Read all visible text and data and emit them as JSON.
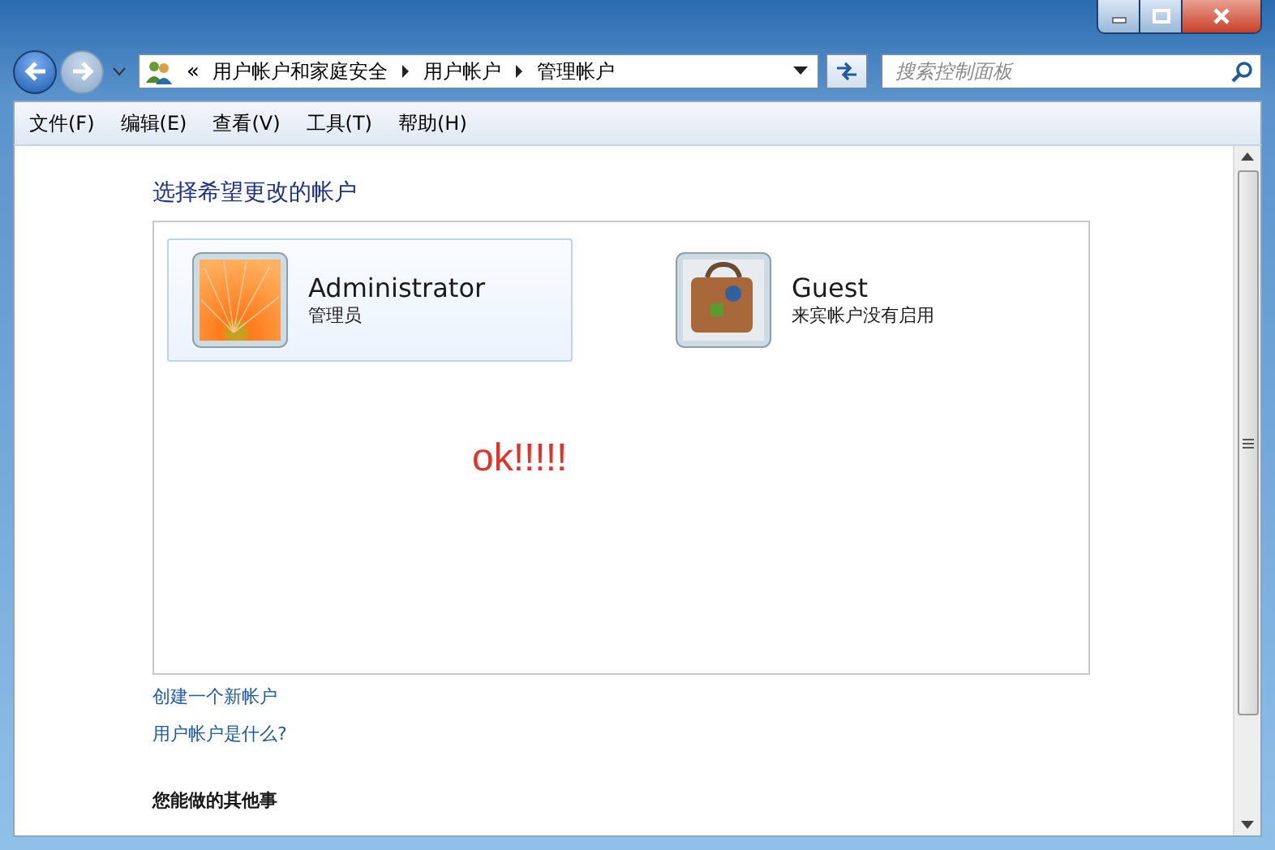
{
  "address_bar": {
    "overflow": "«",
    "path": [
      "用户帐户和家庭安全",
      "用户帐户",
      "管理帐户"
    ]
  },
  "search": {
    "placeholder": "搜索控制面板"
  },
  "menu": [
    "文件(F)",
    "编辑(E)",
    "查看(V)",
    "工具(T)",
    "帮助(H)"
  ],
  "heading": "选择希望更改的帐户",
  "accounts": [
    {
      "name": "Administrator",
      "role": "管理员",
      "kind": "flower",
      "selected": true
    },
    {
      "name": "Guest",
      "role": "来宾帐户没有启用",
      "kind": "suitcase",
      "selected": false
    }
  ],
  "annotation": "ok!!!!!",
  "links": [
    "创建一个新帐户",
    "用户帐户是什么?"
  ],
  "section_heading": "您能做的其他事"
}
